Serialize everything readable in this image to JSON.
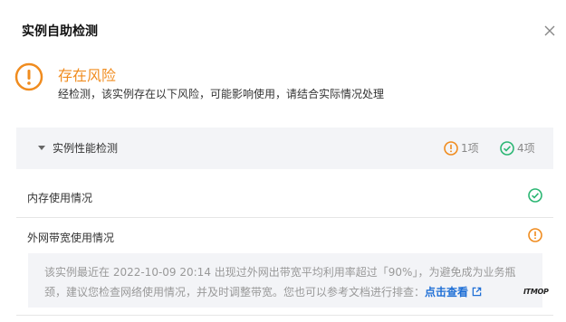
{
  "dialog": {
    "title": "实例自助检测"
  },
  "status": {
    "title": "存在风险",
    "description": "经检测，该实例存在以下风险，可能影响使用，请结合实际情况处理",
    "icon": "warning-circle-icon",
    "color": "#f08c1f"
  },
  "group": {
    "label": "实例性能检测",
    "warning_count": "1项",
    "ok_count": "4项",
    "warning_color": "#f08c1f",
    "ok_color": "#2bb673"
  },
  "items": [
    {
      "label": "内存使用情况",
      "status": "ok"
    },
    {
      "label": "外网带宽使用情况",
      "status": "warning"
    }
  ],
  "detail": {
    "text": "该实例最近在 2022-10-09 20:14 出现过外网出带宽平均利用率超过「90%」，为避免成为业务瓶颈，建议您检查网络使用情况，并及时调整带宽。您也可以参考文档进行排查：",
    "link_label": "点击查看"
  },
  "watermark": "ITMOP"
}
